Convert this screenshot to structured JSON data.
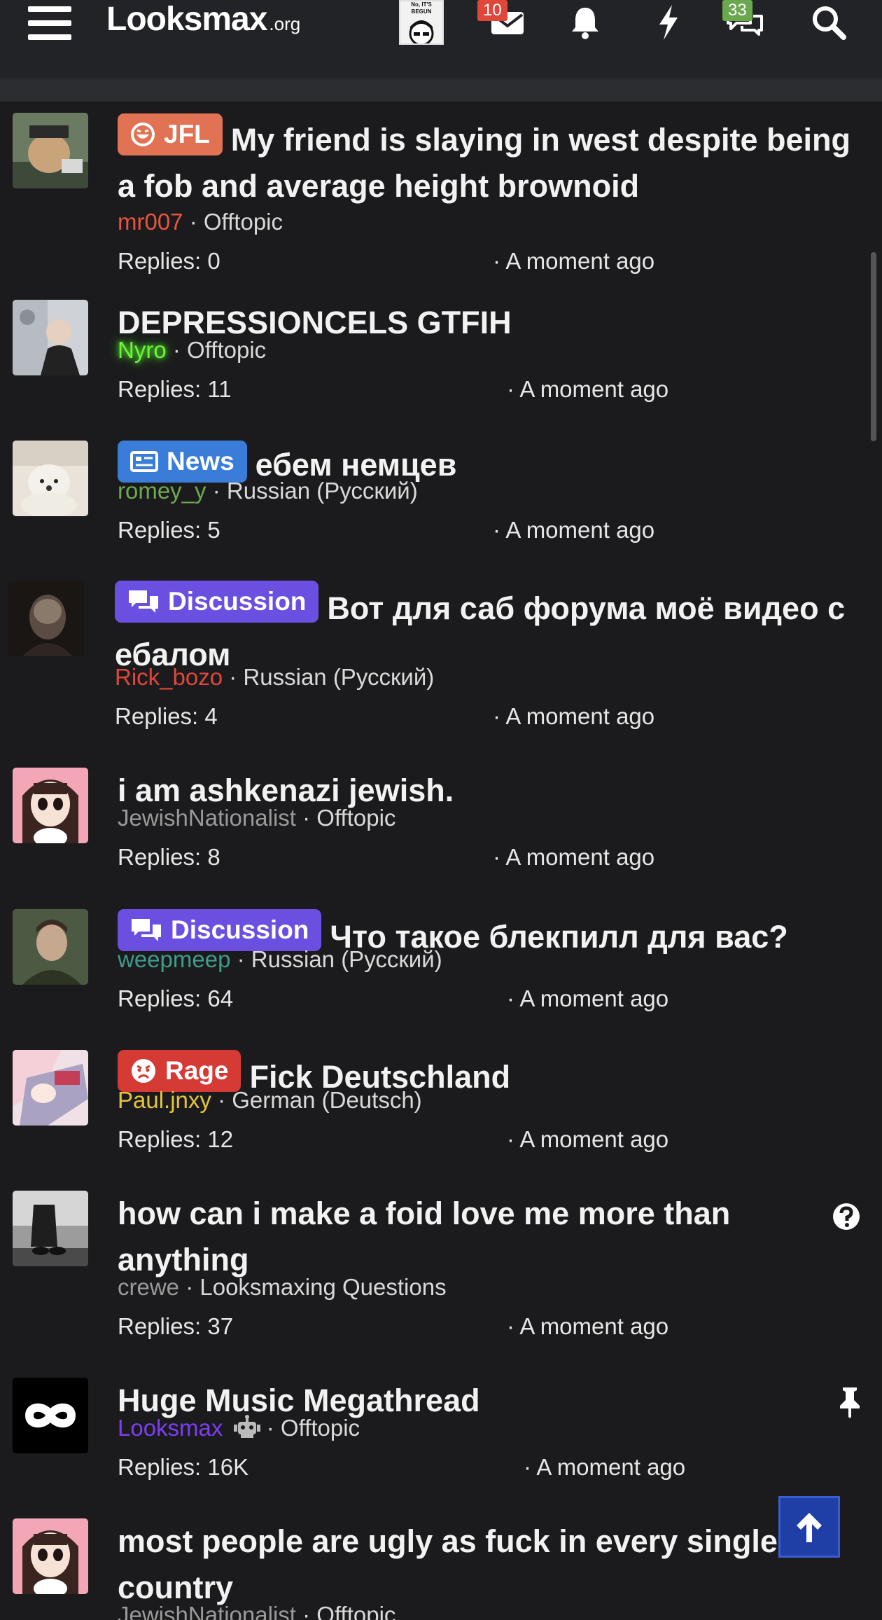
{
  "header": {
    "logo_main": "Looksmax",
    "logo_tld": ".org",
    "avatar_caption": "No, IT'S BEGUN",
    "messages_count": "10",
    "conversations_count": "33"
  },
  "threads": [
    {
      "prefix": "JFL",
      "prefix_color": "#e27254",
      "title": "My friend is slaying in west despite being a fob and average height brownoid",
      "author": "mr007",
      "author_color": "#e8543e",
      "forum": "Offtopic",
      "replies": "Replies: 0",
      "time": "· A moment ago"
    },
    {
      "prefix": "",
      "title": "DEPRESSIONCELS GTFIH",
      "author": "Nyro",
      "author_color": "#6df53a",
      "forum": "Offtopic",
      "replies": "Replies: 11",
      "time": "· A moment ago"
    },
    {
      "prefix": "News",
      "prefix_color": "#3a7dd8",
      "title": "ебем немцев",
      "author": "romey_y",
      "author_color": "#6fa84d",
      "forum": "Russian (Русский)",
      "replies": "Replies: 5",
      "time": "· A moment ago"
    },
    {
      "prefix": "Discussion",
      "prefix_color": "#6a4fe0",
      "title": "Вот для саб форума моё видео с ебалом",
      "author": "Rick_bozo",
      "author_color": "#e0473a",
      "forum": "Russian (Русский)",
      "replies": "Replies: 4",
      "time": "· A moment ago"
    },
    {
      "prefix": "",
      "title": "i am ashkenazi jewish.",
      "author": "JewishNationalist",
      "author_color": "#9a9a9a",
      "forum": "Offtopic",
      "replies": "Replies: 8",
      "time": "· A moment ago"
    },
    {
      "prefix": "Discussion",
      "prefix_color": "#6a4fe0",
      "title": "Что такое блекпилл для вас?",
      "author": "weepmeep",
      "author_color": "#3f9b8c",
      "forum": "Russian (Русский)",
      "replies": "Replies: 64",
      "time": "· A moment ago"
    },
    {
      "prefix": "Rage",
      "prefix_color": "#d63a35",
      "title": "Fick Deutschland",
      "author": "Paul.jnxy",
      "author_color": "#e6c43a",
      "forum": "German (Deutsch)",
      "replies": "Replies: 12",
      "time": "· A moment ago"
    },
    {
      "prefix": "",
      "title": "how can i make a foid love me more than anything",
      "author": "crewe",
      "author_color": "#9a9a9a",
      "forum": "Looksmaxing Questions",
      "replies": "Replies: 37",
      "time": "· A moment ago",
      "status_icon": "question-icon"
    },
    {
      "prefix": "",
      "title": "Huge Music Megathread",
      "author": "Looksmax",
      "author_color": "#7b3ff2",
      "forum": "Offtopic",
      "replies": "Replies: 16K",
      "time": "· A moment ago",
      "status_icon": "pin-icon"
    },
    {
      "prefix": "",
      "title": "most people are ugly as fuck in every single country",
      "author": "JewishNationalist",
      "author_color": "#9a9a9a",
      "forum": "Offtopic",
      "replies": "",
      "time": ""
    }
  ],
  "sep": "·"
}
